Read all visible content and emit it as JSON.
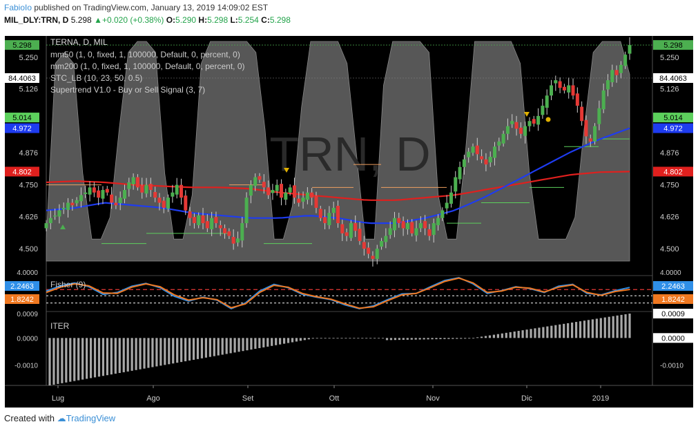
{
  "header": {
    "user": "FabioIo",
    "published": "published on TradingView.com, January 13, 2019 14:09:02 EST",
    "symbol": "MIL_DLY:TRN, D",
    "last": "5.298",
    "change": "+0.020 (+0.38%)",
    "o_label": "O:",
    "o": "5.290",
    "h_label": "H:",
    "h": "5.298",
    "l_label": "L:",
    "l": "5.254",
    "c_label": "C:",
    "c": "5.298"
  },
  "footer": {
    "created_with": "Created with",
    "brand": "TradingView"
  },
  "legend": {
    "title": "TERNA, D, MIL",
    "lines": [
      "mm50 (1, 0, fixed, 1, 100000, Default, 0, percent, 0)",
      "mm200 (1, 0, fixed, 1, 100000, Default, 0, percent, 0)",
      "STC_LB (10, 23, 50, 0.5)",
      "Supertrend V1.0 - Buy or Sell Signal (3, 7)"
    ],
    "watermark": "TRN, D"
  },
  "colors": {
    "up": "#4caf50",
    "down": "#e53935",
    "mm50": "#1e3cf0",
    "mm200": "#e0201e",
    "stc_fill": "#666666",
    "fisher_blue": "#2f8fe8",
    "fisher_orange": "#f07820",
    "supertrend_up": "#5cd05c",
    "supertrend_down": "#f0a060",
    "iter_bar": "#a8a8a8"
  },
  "chart_data": [
    {
      "type": "candlestick",
      "title": "TERNA, D, MIL",
      "x_axis_labels": [
        "Lug",
        "Ago",
        "Set",
        "Ott",
        "Nov",
        "Dic",
        "2019"
      ],
      "y_axis_labels": [
        "5.250",
        "5.126",
        "4.876",
        "4.750",
        "4.626",
        "4.500"
      ],
      "ylim": [
        4.4,
        5.32
      ],
      "price_labels": [
        {
          "value": "5.298",
          "color": "#4caf50"
        },
        {
          "value": "84.4063",
          "color": "#ffffff"
        },
        {
          "value": "5.014",
          "color": "#5cd05c"
        },
        {
          "value": "4.972",
          "color": "#1e3cf0"
        },
        {
          "value": "4.802",
          "color": "#e0201e"
        }
      ],
      "closes": [
        4.6,
        4.62,
        4.63,
        4.65,
        4.66,
        4.68,
        4.67,
        4.69,
        4.71,
        4.72,
        4.74,
        4.72,
        4.7,
        4.73,
        4.72,
        4.68,
        4.67,
        4.7,
        4.73,
        4.76,
        4.78,
        4.74,
        4.72,
        4.75,
        4.73,
        4.7,
        4.68,
        4.66,
        4.7,
        4.72,
        4.75,
        4.7,
        4.65,
        4.62,
        4.6,
        4.63,
        4.6,
        4.58,
        4.62,
        4.6,
        4.58,
        4.56,
        4.55,
        4.52,
        4.54,
        4.6,
        4.7,
        4.75,
        4.78,
        4.77,
        4.74,
        4.71,
        4.73,
        4.75,
        4.7,
        4.72,
        4.74,
        4.7,
        4.68,
        4.7,
        4.72,
        4.7,
        4.66,
        4.62,
        4.6,
        4.64,
        4.66,
        4.6,
        4.56,
        4.55,
        4.6,
        4.57,
        4.53,
        4.5,
        4.48,
        4.46,
        4.5,
        4.53,
        4.55,
        4.58,
        4.62,
        4.6,
        4.58,
        4.6,
        4.56,
        4.58,
        4.6,
        4.58,
        4.55,
        4.6,
        4.62,
        4.65,
        4.68,
        4.72,
        4.78,
        4.82,
        4.85,
        4.88,
        4.9,
        4.87,
        4.85,
        4.83,
        4.86,
        4.9,
        4.92,
        4.95,
        4.98,
        5.0,
        4.97,
        4.95,
        4.98,
        5.0,
        4.99,
        5.02,
        5.06,
        5.1,
        5.14,
        5.16,
        5.13,
        5.12,
        5.14,
        5.1,
        5.06,
        5.0,
        4.94,
        4.92,
        4.98,
        5.05,
        5.12,
        5.16,
        5.2,
        5.18,
        5.22,
        5.26,
        5.298
      ],
      "mm50": [
        4.65,
        4.66,
        4.68,
        4.67,
        4.66,
        4.64,
        4.63,
        4.62,
        4.62,
        4.63,
        4.62,
        4.6,
        4.6,
        4.62,
        4.65,
        4.7,
        4.76,
        4.82,
        4.88,
        4.93,
        4.972
      ],
      "mm200": [
        4.76,
        4.765,
        4.76,
        4.75,
        4.745,
        4.74,
        4.74,
        4.735,
        4.72,
        4.71,
        4.7,
        4.69,
        4.69,
        4.7,
        4.71,
        4.73,
        4.75,
        4.77,
        4.79,
        4.8,
        4.802
      ],
      "stc_lb_current": 84.4063,
      "supertrend_current": 5.014
    },
    {
      "type": "line",
      "title": "Fisher (9)",
      "y_axis_labels": [
        "4.0000"
      ],
      "price_labels": [
        {
          "value": "2.2463",
          "color": "#2f8fe8"
        },
        {
          "value": "1.8242",
          "color": "#f07820"
        }
      ],
      "series": [
        {
          "name": "Fisher",
          "values": [
            1.5,
            2.6,
            3.2,
            2.4,
            0.8,
            1.2,
            2.5,
            3.1,
            2.2,
            0.4,
            -0.6,
            0.2,
            -0.4,
            -2.2,
            -1.0,
            1.5,
            2.9,
            2.2,
            0.8,
            0.2,
            -0.3,
            -1.4,
            -2.2,
            -1.6,
            -0.3,
            0.9,
            1.0,
            2.4,
            3.7,
            4.3,
            3.0,
            1.0,
            1.6,
            2.4,
            2.0,
            1.2,
            2.5,
            2.9,
            1.0,
            0.7,
            1.6,
            2.2463
          ]
        },
        {
          "name": "Trigger",
          "values": [
            1.2,
            2.3,
            3.0,
            2.6,
            1.1,
            1.0,
            2.3,
            3.0,
            2.4,
            0.7,
            -0.4,
            0.1,
            -0.3,
            -2.0,
            -1.2,
            1.2,
            2.7,
            2.3,
            1.0,
            0.3,
            -0.2,
            -1.2,
            -2.1,
            -1.8,
            -0.5,
            0.7,
            1.0,
            2.2,
            3.5,
            4.2,
            3.2,
            1.2,
            1.5,
            2.3,
            2.1,
            1.3,
            2.3,
            2.8,
            1.2,
            0.6,
            1.4,
            1.8242
          ]
        }
      ]
    },
    {
      "type": "bar",
      "title": "ITER",
      "y_axis_labels": [
        "0.0009",
        "0.0000",
        "-0.0010"
      ],
      "price_labels": [
        {
          "value": "0.0009",
          "color": "#ffffff"
        },
        {
          "value": "0.0000",
          "color": "#ffffff"
        }
      ],
      "ylim": [
        -0.00175,
        0.0009
      ]
    }
  ]
}
